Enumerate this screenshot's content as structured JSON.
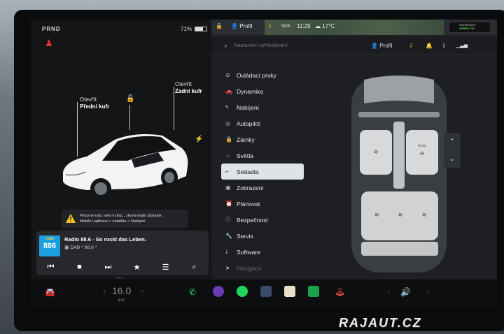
{
  "status": {
    "gear": "PRND",
    "battery_pct": "71%",
    "battery_level": 0.71,
    "profile": "Profil",
    "time": "11:29",
    "outside_temp": "17°C",
    "airbag_line1": "PASSENGER",
    "airbag_line2": "AIRBAG ON"
  },
  "car": {
    "frunk_line1": "Otevřít",
    "frunk_line2": "Přední kufr",
    "trunk_line1": "Otevřít",
    "trunk_line2": "Zadní kufr"
  },
  "warning": {
    "line1": "Placené nab. není k disp., zkontrolujte zůstatek",
    "line2": "Mobilní aplikace > nabídka > Nabíjení"
  },
  "media": {
    "logo_top": "radio",
    "logo_main": "886",
    "station": "Radio 88.6 - So rockt das Leben.",
    "source": "DAB * 88.6 *"
  },
  "search": {
    "placeholder": "Nastavení vyhledávání",
    "profile": "Profil"
  },
  "menu": [
    {
      "label": "Ovládací prvky",
      "icon": "toggle-icon"
    },
    {
      "label": "Dynamika",
      "icon": "car-icon"
    },
    {
      "label": "Nabíjení",
      "icon": "bolt-icon"
    },
    {
      "label": "Autopilot",
      "icon": "steering-wheel-icon"
    },
    {
      "label": "Zámky",
      "icon": "lock-icon"
    },
    {
      "label": "Světla",
      "icon": "sun-icon"
    },
    {
      "label": "Sedadla",
      "icon": "seat-icon"
    },
    {
      "label": "Zobrazení",
      "icon": "display-icon"
    },
    {
      "label": "Plánovat",
      "icon": "clock-icon"
    },
    {
      "label": "Bezpečnost",
      "icon": "info-icon"
    },
    {
      "label": "Servis",
      "icon": "wrench-icon"
    },
    {
      "label": "Software",
      "icon": "download-icon"
    },
    {
      "label": "Navigace",
      "icon": "navigation-icon"
    }
  ],
  "active_menu": "Sedadla",
  "seats": {
    "auto_label_front": "Auto",
    "auto_label_right": "Auto"
  },
  "dock": {
    "temp": "16.0",
    "temp_unit": ""
  },
  "watermark": "RAJAUT.CZ",
  "colors": {
    "active_bg": "#dfe3e7",
    "warning": "#f5c518",
    "seatbelt": "#e03131",
    "radio": "#1b9fe0"
  }
}
